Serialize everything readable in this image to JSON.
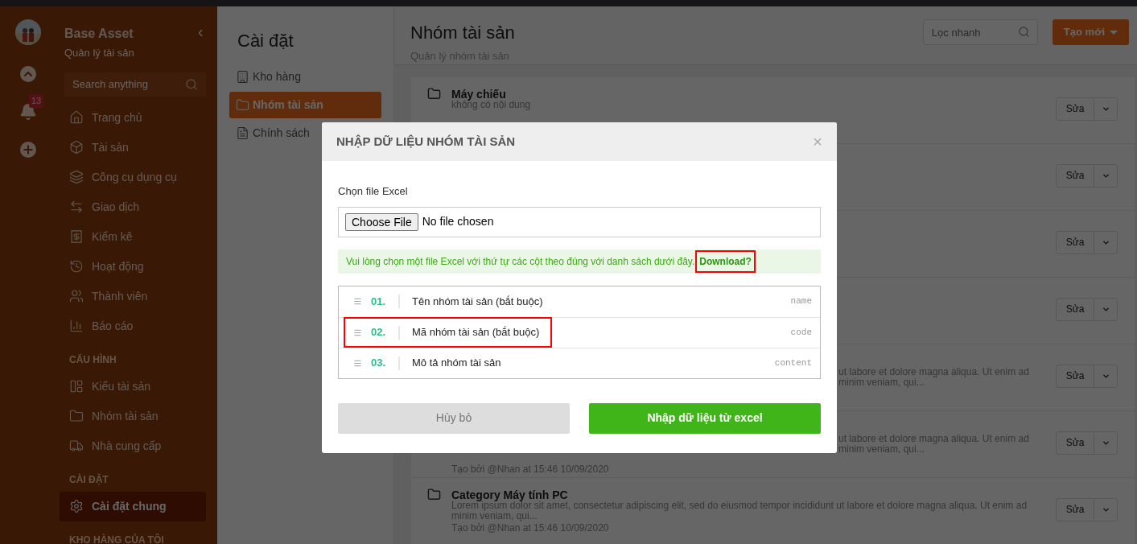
{
  "rail": {
    "notification_count": "13"
  },
  "sidebar": {
    "title": "Base Asset",
    "subtitle": "Quản lý tài sản",
    "search": {
      "placeholder": "Search anything"
    },
    "sections": [
      {
        "items": [
          {
            "label": "Trang chủ",
            "selected": false
          },
          {
            "label": "Tài sản",
            "selected": false
          },
          {
            "label": "Công cụ dụng cụ",
            "selected": false
          },
          {
            "label": "Giao dịch",
            "selected": false
          },
          {
            "label": "Kiểm kê",
            "selected": false
          },
          {
            "label": "Hoạt động",
            "selected": false
          },
          {
            "label": "Thành viên",
            "selected": false
          },
          {
            "label": "Báo cáo",
            "selected": false
          }
        ]
      },
      {
        "heading": "CẤU HÌNH",
        "items": [
          {
            "label": "Kiểu tài sản",
            "selected": false
          },
          {
            "label": "Nhóm tài sản",
            "selected": false
          },
          {
            "label": "Nhà cung cấp",
            "selected": false
          }
        ]
      },
      {
        "heading": "CÀI ĐẶT",
        "items": [
          {
            "label": "Cài đặt chung",
            "selected": true
          }
        ]
      },
      {
        "heading": "KHO HÀNG CỦA TÔI"
      }
    ]
  },
  "settings_panel": {
    "title": "Cài đặt",
    "items": [
      {
        "label": "Kho hàng",
        "selected": false
      },
      {
        "label": "Nhóm tài sản",
        "selected": true
      },
      {
        "label": "Chính sách",
        "selected": false
      }
    ]
  },
  "main": {
    "title": "Nhóm tài sản",
    "subtitle": "Quản lý nhóm tài sản",
    "filter": {
      "placeholder": "Lọc nhanh"
    },
    "create_button": "Tạo mới",
    "cards": [
      {
        "kind": "full",
        "title": "Máy chiếu",
        "description": "không có nội dung",
        "edit": "Sửa"
      },
      {
        "kind": "covered",
        "edit": "Sửa"
      },
      {
        "kind": "covered",
        "edit": "Sửa"
      },
      {
        "kind": "covered",
        "edit": "Sửa"
      },
      {
        "kind": "covered",
        "description": "ut labore et dolore magna aliqua. Ut enim ad minim veniam, qui...",
        "edit": "Sửa"
      },
      {
        "kind": "covered",
        "description": "ut labore et dolore magna aliqua. Ut enim ad minim veniam, qui...",
        "created": "Tạo bởi @Nhan at 15:46 10/09/2020",
        "edit": "Sửa"
      },
      {
        "kind": "full",
        "title": "Category Máy tính PC",
        "description": "Lorem ipsum dolor sit amet, consectetur adipiscing elit, sed do eiusmod tempor incididunt ut labore et dolore magna aliqua. Ut enim ad minim veniam, qui...",
        "created": "Tạo bởi @Nhan at 15:46 10/09/2020",
        "edit": "Sửa"
      }
    ]
  },
  "modal": {
    "title": "NHẬP DỮ LIỆU NHÓM TÀI SẢN",
    "close": "×",
    "file_label": "Chọn file Excel",
    "file_button": "Choose File",
    "file_status": "No file chosen",
    "notice": "Vui lòng chọn một file Excel với thứ tự các cột theo đúng với danh sách dưới đây.",
    "download_link": {
      "label": "Download?",
      "highlighted": true
    },
    "columns": [
      {
        "number": "01.",
        "label": "Tên nhóm tài sản (bắt buộc)",
        "key": "name",
        "highlighted": false
      },
      {
        "number": "02.",
        "label": "Mã nhóm tài sản (bắt buộc)",
        "key": "code",
        "highlighted": true
      },
      {
        "number": "03.",
        "label": "Mô tả nhóm tài sản",
        "key": "content",
        "highlighted": false
      }
    ],
    "cancel": "Hủy bỏ",
    "submit": "Nhập dữ liệu từ excel"
  }
}
